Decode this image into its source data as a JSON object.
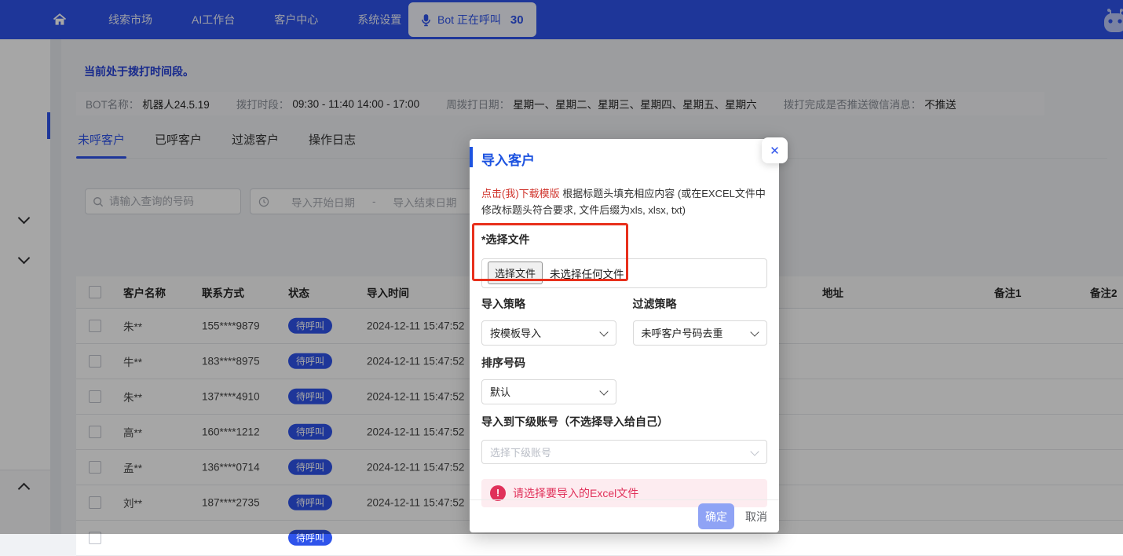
{
  "colors": {
    "accent": "#2f54eb",
    "navbar_bg": "#2f54eb",
    "modal_title": "#1d53e0",
    "tip_link_red": "#d0342c",
    "error_rose": "#e0315a",
    "annotation_red": "#e8301c",
    "badge_bg": "#2f54eb"
  },
  "navbar": {
    "items": [
      {
        "label": "线索市场"
      },
      {
        "label": "AI工作台"
      },
      {
        "label": "客户中心"
      },
      {
        "label": "系统设置"
      }
    ],
    "bot_button": {
      "label": "Bot 正在呼叫",
      "count": "30"
    }
  },
  "status_banner": "当前处于拨打时间段。",
  "bot_info": {
    "fields": [
      {
        "label": "BOT名称：",
        "value": "机器人24.5.19"
      },
      {
        "label": "拨打时段：",
        "value": "09:30 - 11:40 14:00 - 17:00"
      },
      {
        "label": "周拨打日期：",
        "value": "星期一、星期二、星期三、星期四、星期五、星期六"
      },
      {
        "label": "拨打完成是否推送微信消息：",
        "value": "不推送"
      }
    ]
  },
  "tabs": [
    {
      "label": "未呼客户",
      "active": true
    },
    {
      "label": "已呼客户",
      "active": false
    },
    {
      "label": "过滤客户",
      "active": false
    },
    {
      "label": "操作日志",
      "active": false
    }
  ],
  "filters": {
    "search_placeholder": "请输入查询的号码",
    "date_start": "导入开始日期",
    "date_separator": "-",
    "date_end": "导入结束日期"
  },
  "table": {
    "headers": [
      "客户名称",
      "联系方式",
      "状态",
      "导入时间",
      "地址",
      "备注1",
      "备注2"
    ],
    "rows": [
      {
        "name": "朱**",
        "phone": "155****9879",
        "status": "待呼叫",
        "time": "2024-12-11 15:47:52"
      },
      {
        "name": "牛**",
        "phone": "183****8975",
        "status": "待呼叫",
        "time": "2024-12-11 15:47:52"
      },
      {
        "name": "朱**",
        "phone": "137****4910",
        "status": "待呼叫",
        "time": "2024-12-11 15:47:52"
      },
      {
        "name": "高**",
        "phone": "160****1212",
        "status": "待呼叫",
        "time": "2024-12-11 15:47:52"
      },
      {
        "name": "孟**",
        "phone": "136****0714",
        "status": "待呼叫",
        "time": "2024-12-11 15:47:52"
      },
      {
        "name": "刘**",
        "phone": "187****2735",
        "status": "待呼叫",
        "time": "2024-12-11 15:47:52"
      },
      {
        "name": "",
        "phone": "",
        "status": "待呼叫",
        "time": ""
      }
    ]
  },
  "modal": {
    "title": "导入客户",
    "close_glyph": "✕",
    "tip_link": "点击(我)下载模版",
    "tip_rest": " 根据标题头填充相应内容 (或在EXCEL文件中修改标题头符合要求, 文件后缀为xls, xlsx, txt)",
    "file_label": "*选择文件",
    "file_button": "选择文件",
    "file_empty": "未选择任何文件",
    "import_strategy_label": "导入策略",
    "import_strategy_value": "按模板导入",
    "filter_strategy_label": "过滤策略",
    "filter_strategy_value": "未呼客户号码去重",
    "sort_label": "排序号码",
    "sort_value": "默认",
    "sub_account_label": "导入到下级账号（不选择导入给自己）",
    "sub_account_placeholder": "选择下级账号",
    "error_icon_glyph": "!",
    "error_text": "请选择要导入的Excel文件",
    "ok_label": "确定",
    "cancel_label": "取消"
  }
}
